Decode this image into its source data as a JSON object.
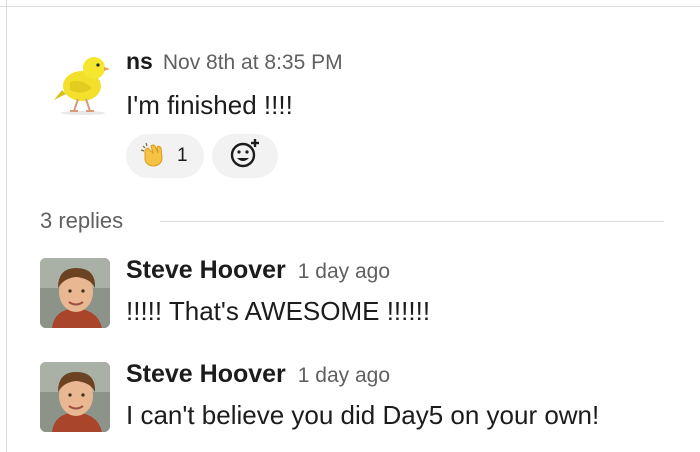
{
  "parent_message": {
    "sender": "ns",
    "timestamp": "Nov 8th at 8:35 PM",
    "text": "I'm finished !!!!",
    "avatar_icon": "canary-bird-avatar",
    "reactions": [
      {
        "emoji": "clapping-hands-icon",
        "count": "1"
      }
    ],
    "add_reaction_icon": "add-emoji-icon"
  },
  "thread": {
    "replies_label": "3 replies"
  },
  "replies": [
    {
      "sender": "Steve Hoover",
      "time": "1 day ago",
      "text": "!!!!! That's AWESOME !!!!!!",
      "avatar_icon": "user-photo-avatar"
    },
    {
      "sender": "Steve Hoover",
      "time": "1 day ago",
      "text": "I can't believe you did Day5 on your own!",
      "avatar_icon": "user-photo-avatar"
    }
  ],
  "colors": {
    "text": "#1d1c1d",
    "muted": "#616061",
    "pill_bg": "#f2f2f2",
    "divider": "#dddddd"
  }
}
